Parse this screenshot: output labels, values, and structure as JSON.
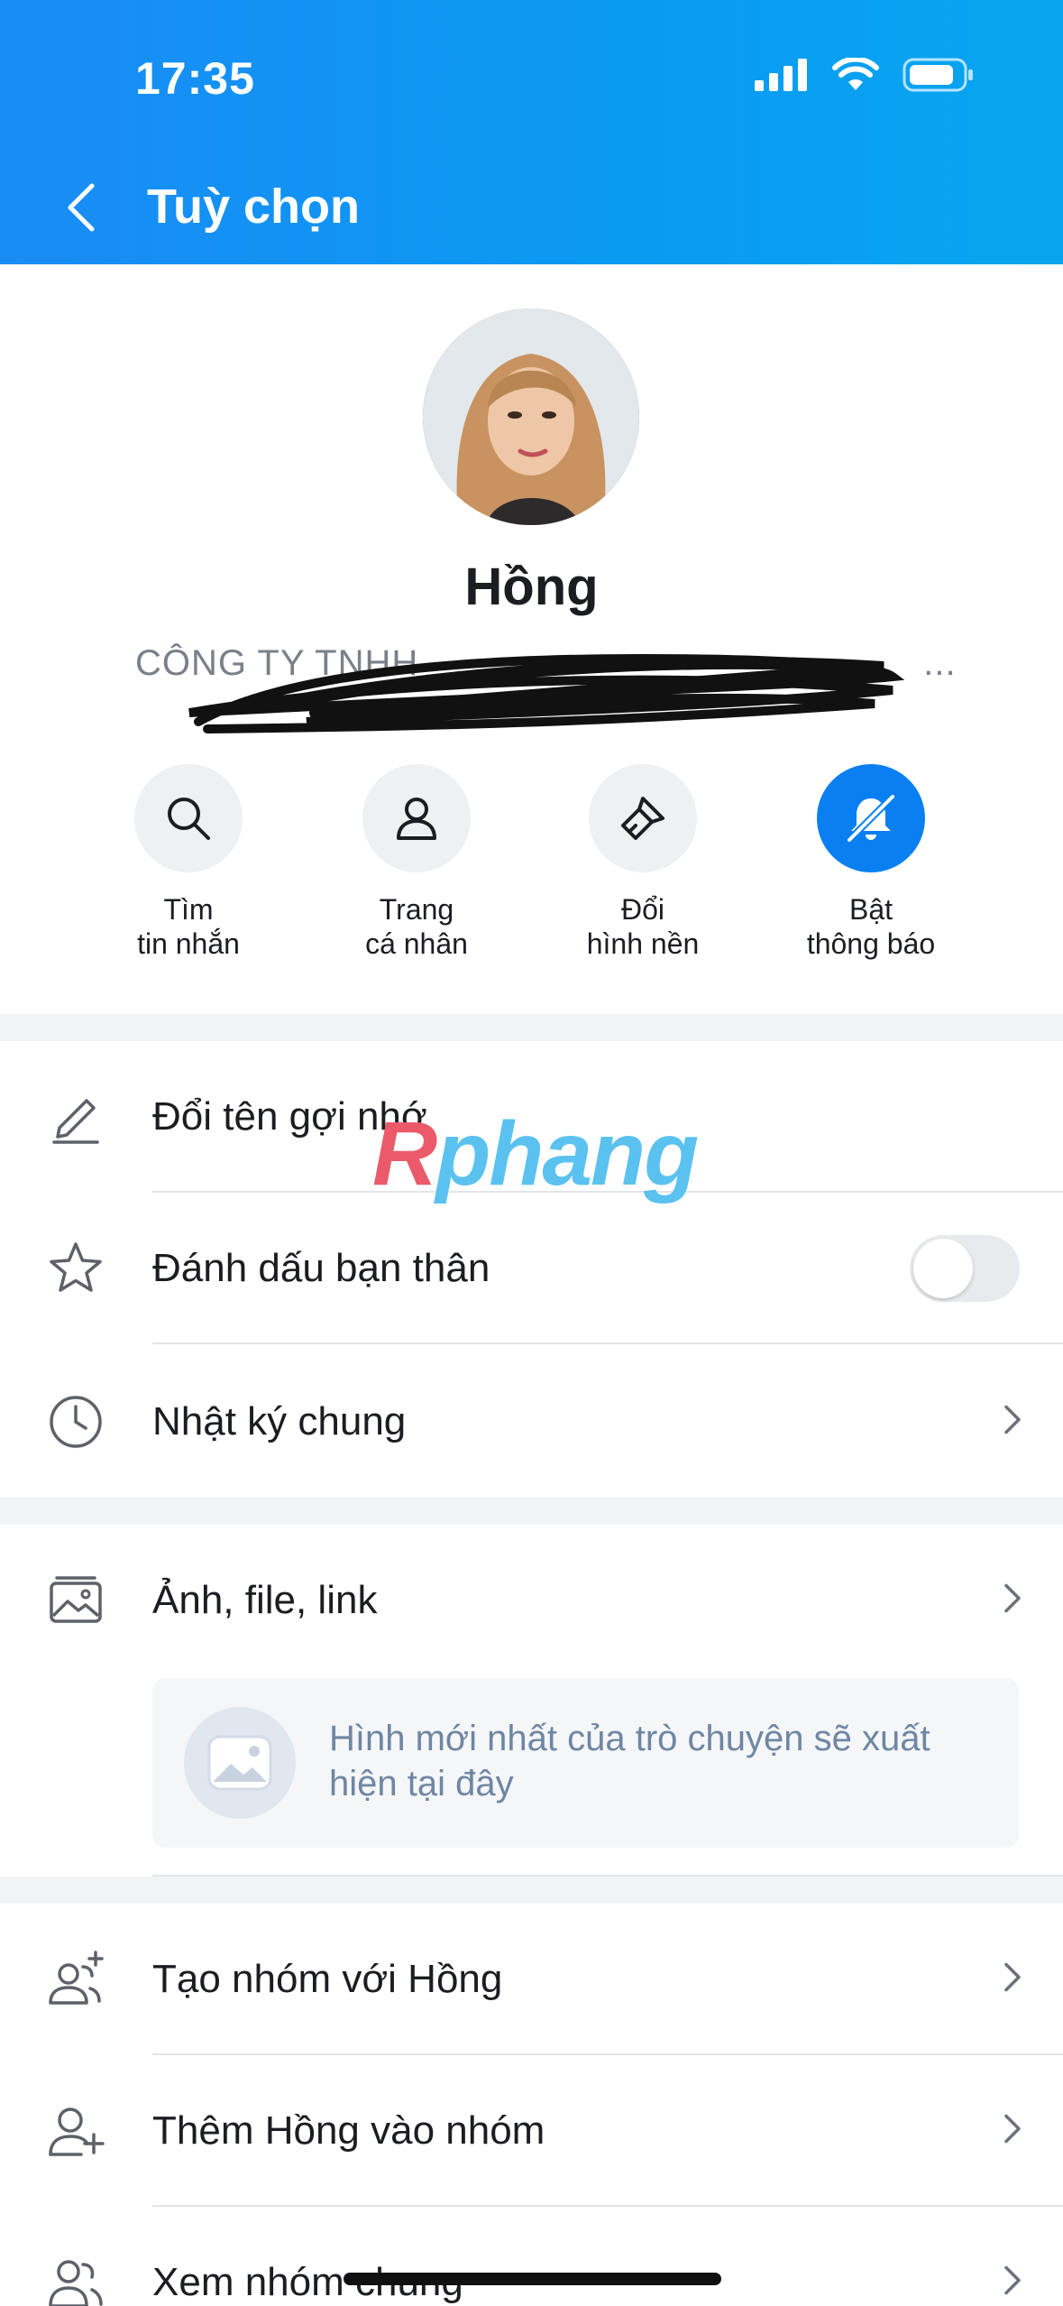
{
  "status_bar": {
    "time": "17:35"
  },
  "header": {
    "title": "Tuỳ chọn"
  },
  "profile": {
    "name": "Hồng",
    "company": "CÔNG TY TNHH",
    "company_tail": "..."
  },
  "actions": [
    {
      "line1": "Tìm",
      "line2": "tin nhắn",
      "icon": "search-icon"
    },
    {
      "line1": "Trang",
      "line2": "cá nhân",
      "icon": "user-icon"
    },
    {
      "line1": "Đổi",
      "line2": "hình nền",
      "icon": "brush-icon"
    },
    {
      "line1": "Bật",
      "line2": "thông báo",
      "icon": "bell-off-icon"
    }
  ],
  "menu": {
    "rename": "Đổi tên gợi nhớ",
    "best_friend": "Đánh dấu bạn thân",
    "best_friend_on": false,
    "diary": "Nhật ký chung",
    "media": "Ảnh, file, link",
    "media_placeholder": "Hình mới nhất của trò chuyện sẽ xuất hiện tại đây",
    "create_group": "Tạo nhóm với Hồng",
    "add_to_group": "Thêm Hồng vào nhóm",
    "common_groups": "Xem nhóm chung"
  },
  "watermark": {
    "first": "R",
    "rest": "phang"
  },
  "colors": {
    "header": "#1a8cf5",
    "accent": "#0a7ff2"
  }
}
